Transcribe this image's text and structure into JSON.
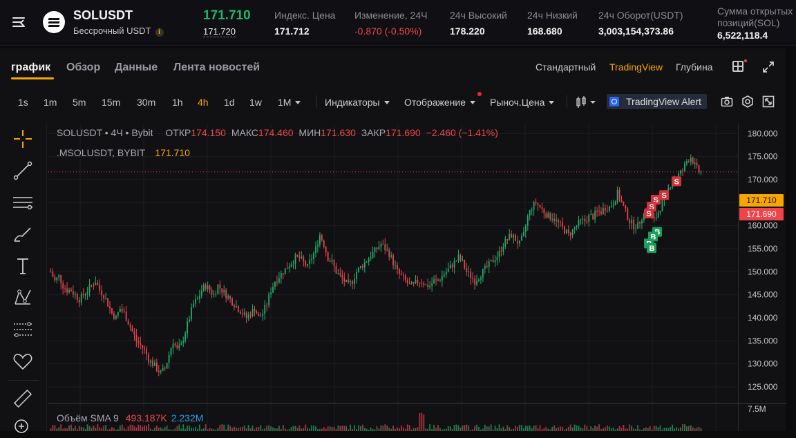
{
  "header": {
    "symbol": "SOLUSDT",
    "contract_type": "Бессрочный USDT",
    "info_icon": "info-icon",
    "last_price": "171.710",
    "mark_price": "171.720",
    "stats": [
      {
        "label": "Индекс. Цена",
        "value": "171.712",
        "negative": false
      },
      {
        "label": "Изменение, 24Ч",
        "value": "-0.870 (-0.50%)",
        "negative": true
      },
      {
        "label": "24ч Высокий",
        "value": "178.220",
        "negative": false
      },
      {
        "label": "24ч Низкий",
        "value": "168.680",
        "negative": false
      },
      {
        "label": "24ч Оборот(USDT)",
        "value": "3,003,154,373.86",
        "negative": false
      }
    ],
    "open_interest": {
      "label_line1": "Сумма открытых",
      "label_line2": "позиций(SOL)",
      "value": "6,522,118.4"
    }
  },
  "tabs": [
    "график",
    "Обзор",
    "Данные",
    "Лента новостей"
  ],
  "active_tab": "график",
  "views": [
    "Стандартный",
    "TradingView",
    "Глубина"
  ],
  "active_view": "TradingView",
  "timeframes": [
    "1s",
    "1m",
    "5m",
    "15m",
    "30m",
    "1h",
    "4h",
    "1d",
    "1w",
    "1M"
  ],
  "active_timeframe": "4h",
  "toolbar": {
    "indicators": "Индикаторы",
    "display": "Отображение",
    "price_type": "Рыноч.Цена",
    "alert": "TradingView Alert"
  },
  "left_tool_icons": [
    "crosshair-icon",
    "trend-line-icon",
    "horizontal-lines-icon",
    "brush-icon",
    "text-icon",
    "pattern-icon",
    "fib-icon",
    "favorite-icon",
    "ruler-icon",
    "zoom-in-icon"
  ],
  "legend": {
    "title": "SOLUSDT • 4Ч • Bybit",
    "open_label": "ОТКР",
    "open": "174.150",
    "high_label": "МАКС",
    "high": "174.460",
    "low_label": "МИН",
    "low": "171.630",
    "close_label": "ЗАКР",
    "close": "171.690",
    "change": "−2.460 (−1.41%)",
    "mark_symbol": ".MSOLUSDT, BYBIT",
    "mark_value": "171.710",
    "volume_label": "Объём SMA 9",
    "volume_value": "493.187K",
    "volume_sma": "2.232M"
  },
  "colors": {
    "up": "#20b26c",
    "down": "#ef454a",
    "accent": "#f7a600"
  },
  "chart_data": {
    "type": "candlestick",
    "ylim": [
      122,
      182
    ],
    "y_ticks": [
      "180.000",
      "175.000",
      "170.000",
      "165.000",
      "160.000",
      "155.000",
      "150.000",
      "145.000",
      "140.000",
      "135.000",
      "130.000",
      "125.000"
    ],
    "y_tick_values": [
      180,
      175,
      170,
      165,
      160,
      155,
      150,
      145,
      140,
      135,
      130,
      125
    ],
    "volume_tick": "7.5M",
    "last_price_tag": "171.710",
    "mark_price_tag": "171.690",
    "close_path": [
      150,
      148,
      149,
      147,
      146,
      146,
      145,
      144,
      145,
      146,
      147,
      148,
      146,
      145,
      143,
      141,
      140,
      142,
      141,
      139,
      137,
      135,
      134,
      133,
      131,
      130,
      129,
      128,
      129,
      132,
      135,
      133,
      134,
      137,
      140,
      143,
      144,
      146,
      147,
      146,
      145,
      147,
      146,
      145,
      144,
      143,
      142,
      141,
      140,
      141,
      142,
      140,
      141,
      143,
      146,
      148,
      149,
      150,
      151,
      152,
      153,
      153,
      152,
      151,
      153,
      155,
      158,
      156,
      153,
      152,
      150,
      149,
      148,
      147,
      148,
      150,
      151,
      152,
      153,
      154,
      155,
      156,
      155,
      154,
      152,
      150,
      149,
      148,
      147,
      147,
      148,
      148,
      147,
      147,
      148,
      148,
      149,
      150,
      151,
      152,
      153,
      152,
      150,
      149,
      148,
      149,
      150,
      151,
      152,
      153,
      154,
      156,
      157,
      158,
      157,
      156,
      158,
      162,
      164,
      165,
      164,
      163,
      162,
      162,
      161,
      160,
      159,
      158,
      159,
      160,
      161,
      161,
      162,
      162,
      163,
      163,
      164,
      164,
      165,
      167,
      165,
      163,
      161,
      160,
      160,
      162,
      163,
      162,
      161,
      163,
      165,
      167,
      169,
      170,
      171,
      172,
      174,
      175,
      173,
      171.69
    ],
    "markers": [
      {
        "label": "S",
        "type": "sell",
        "price": 169.5
      },
      {
        "label": "S",
        "type": "sell",
        "price": 166.5
      },
      {
        "label": "S",
        "type": "sell",
        "price": 165.5
      },
      {
        "label": "S",
        "type": "sell",
        "price": 164.0
      },
      {
        "label": "S",
        "type": "sell",
        "price": 162.5
      },
      {
        "label": "B",
        "type": "buy",
        "price": 158.5
      },
      {
        "label": "B",
        "type": "buy",
        "price": 157.5
      },
      {
        "label": "B",
        "type": "buy",
        "price": 156.0
      },
      {
        "label": "B",
        "type": "buy",
        "price": 155.0
      }
    ]
  }
}
